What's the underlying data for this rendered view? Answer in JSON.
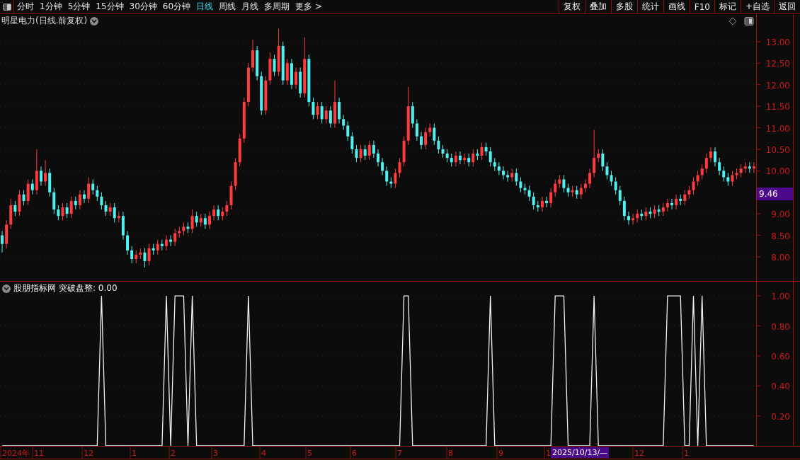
{
  "toolbar": {
    "periods": [
      {
        "label": "分时",
        "selected": false
      },
      {
        "label": "1分钟",
        "selected": false
      },
      {
        "label": "5分钟",
        "selected": false
      },
      {
        "label": "15分钟",
        "selected": false
      },
      {
        "label": "30分钟",
        "selected": false
      },
      {
        "label": "60分钟",
        "selected": false
      },
      {
        "label": "日线",
        "selected": true
      },
      {
        "label": "周线",
        "selected": false
      },
      {
        "label": "月线",
        "selected": false
      },
      {
        "label": "多周期",
        "selected": false
      },
      {
        "label": "更多 >",
        "selected": false
      }
    ],
    "actions": [
      "复权",
      "叠加",
      "多股",
      "统计",
      "画线",
      "F10",
      "标记",
      "+自选",
      "返回"
    ]
  },
  "main_chart": {
    "title": "明星电力(日线.前复权)",
    "current_price": "9.46",
    "chart_data": {
      "type": "candlestick",
      "grid": true,
      "ylim": [
        7.44,
        13.64
      ],
      "yticks": [
        {
          "value": 13,
          "label": "13.00"
        },
        {
          "value": 12.5,
          "label": "12.50"
        },
        {
          "value": 12,
          "label": "12.00"
        },
        {
          "value": 11.5,
          "label": "11.50"
        },
        {
          "value": 11,
          "label": "11.00"
        },
        {
          "value": 10.5,
          "label": "10.50"
        },
        {
          "value": 10,
          "label": "10.00"
        },
        {
          "value": 9,
          "label": "9.00"
        },
        {
          "value": 8.5,
          "label": "8.50"
        },
        {
          "value": 8,
          "label": "8.00"
        }
      ],
      "ohlc": [
        [
          8.5,
          8.6,
          8.1,
          8.3
        ],
        [
          8.3,
          8.85,
          8.2,
          8.75
        ],
        [
          8.75,
          9.35,
          8.65,
          9.2
        ],
        [
          9.2,
          9.3,
          8.95,
          9.05
        ],
        [
          9.05,
          9.55,
          8.95,
          9.45
        ],
        [
          9.45,
          9.55,
          9.2,
          9.3
        ],
        [
          9.3,
          9.8,
          9.2,
          9.7
        ],
        [
          9.7,
          9.8,
          9.45,
          9.55
        ],
        [
          9.55,
          10.5,
          9.45,
          10.0
        ],
        [
          10.0,
          10.1,
          9.65,
          9.75
        ],
        [
          9.75,
          10.25,
          9.65,
          9.95
        ],
        [
          9.95,
          10.05,
          9.4,
          9.5
        ],
        [
          9.5,
          9.6,
          9.0,
          9.1
        ],
        [
          9.1,
          9.2,
          8.85,
          8.95
        ],
        [
          8.95,
          9.25,
          8.85,
          9.15
        ],
        [
          9.15,
          9.25,
          8.9,
          9.0
        ],
        [
          9.0,
          9.4,
          8.9,
          9.3
        ],
        [
          9.3,
          9.4,
          9.1,
          9.2
        ],
        [
          9.2,
          9.55,
          9.1,
          9.45
        ],
        [
          9.45,
          9.55,
          9.25,
          9.35
        ],
        [
          9.35,
          9.85,
          9.25,
          9.7
        ],
        [
          9.7,
          9.8,
          9.45,
          9.55
        ],
        [
          9.55,
          9.65,
          9.3,
          9.4
        ],
        [
          9.4,
          9.5,
          9.1,
          9.2
        ],
        [
          9.2,
          9.3,
          8.95,
          9.05
        ],
        [
          9.05,
          9.25,
          8.95,
          9.15
        ],
        [
          9.15,
          9.25,
          8.8,
          8.9
        ],
        [
          8.9,
          9.05,
          8.8,
          8.95
        ],
        [
          8.95,
          9.05,
          8.4,
          8.5
        ],
        [
          8.5,
          8.6,
          8.05,
          8.15
        ],
        [
          8.15,
          8.25,
          7.85,
          7.95
        ],
        [
          7.95,
          8.15,
          7.85,
          8.05
        ],
        [
          8.05,
          8.2,
          7.95,
          8.1
        ],
        [
          8.1,
          8.2,
          7.75,
          7.9
        ],
        [
          7.9,
          8.3,
          7.8,
          8.2
        ],
        [
          8.2,
          8.3,
          8.05,
          8.15
        ],
        [
          8.15,
          8.4,
          8.05,
          8.3
        ],
        [
          8.3,
          8.4,
          8.15,
          8.25
        ],
        [
          8.25,
          8.5,
          8.15,
          8.4
        ],
        [
          8.4,
          8.5,
          8.25,
          8.35
        ],
        [
          8.35,
          8.65,
          8.25,
          8.55
        ],
        [
          8.55,
          8.7,
          8.45,
          8.6
        ],
        [
          8.6,
          8.8,
          8.5,
          8.7
        ],
        [
          8.7,
          8.8,
          8.55,
          8.65
        ],
        [
          8.65,
          9.1,
          8.55,
          8.95
        ],
        [
          8.95,
          9.05,
          8.7,
          8.8
        ],
        [
          8.8,
          9.0,
          8.7,
          8.9
        ],
        [
          8.9,
          9.0,
          8.65,
          8.75
        ],
        [
          8.75,
          9.05,
          8.65,
          8.95
        ],
        [
          8.95,
          9.2,
          8.85,
          9.1
        ],
        [
          9.1,
          9.2,
          8.85,
          8.95
        ],
        [
          8.95,
          9.15,
          8.85,
          9.05
        ],
        [
          9.05,
          9.3,
          8.95,
          9.2
        ],
        [
          9.2,
          9.75,
          9.1,
          9.65
        ],
        [
          9.65,
          10.3,
          9.55,
          10.2
        ],
        [
          10.2,
          10.85,
          10.1,
          10.75
        ],
        [
          10.75,
          11.7,
          10.65,
          11.6
        ],
        [
          11.6,
          12.5,
          11.5,
          12.4
        ],
        [
          12.4,
          13.05,
          12.3,
          12.8
        ],
        [
          12.8,
          12.9,
          12.1,
          12.2
        ],
        [
          12.2,
          12.3,
          11.3,
          11.4
        ],
        [
          11.4,
          12.2,
          11.3,
          12.1
        ],
        [
          12.1,
          12.75,
          12.0,
          12.6
        ],
        [
          12.6,
          12.7,
          12.2,
          12.3
        ],
        [
          12.3,
          13.3,
          12.2,
          12.9
        ],
        [
          12.9,
          13.0,
          12.0,
          12.1
        ],
        [
          12.1,
          12.6,
          12.0,
          12.5
        ],
        [
          12.5,
          12.6,
          11.9,
          12.0
        ],
        [
          12.0,
          12.4,
          11.9,
          12.3
        ],
        [
          12.3,
          12.4,
          11.7,
          11.8
        ],
        [
          11.8,
          13.1,
          11.7,
          12.6
        ],
        [
          12.6,
          12.7,
          11.5,
          11.6
        ],
        [
          11.6,
          11.7,
          11.2,
          11.3
        ],
        [
          11.3,
          11.6,
          11.2,
          11.5
        ],
        [
          11.5,
          11.6,
          11.1,
          11.2
        ],
        [
          11.2,
          11.5,
          11.1,
          11.4
        ],
        [
          11.4,
          11.5,
          11.0,
          11.1
        ],
        [
          11.1,
          12.1,
          11.0,
          11.6
        ],
        [
          11.6,
          11.7,
          11.1,
          11.2
        ],
        [
          11.2,
          11.3,
          10.95,
          11.05
        ],
        [
          11.05,
          11.15,
          10.7,
          10.8
        ],
        [
          10.8,
          10.9,
          10.4,
          10.5
        ],
        [
          10.5,
          10.6,
          10.2,
          10.3
        ],
        [
          10.3,
          10.6,
          10.2,
          10.5
        ],
        [
          10.5,
          10.6,
          10.25,
          10.35
        ],
        [
          10.35,
          10.7,
          10.25,
          10.6
        ],
        [
          10.6,
          10.7,
          10.3,
          10.4
        ],
        [
          10.4,
          10.5,
          10.1,
          10.2
        ],
        [
          10.2,
          10.3,
          9.9,
          10.0
        ],
        [
          10.0,
          10.1,
          9.65,
          9.75
        ],
        [
          9.75,
          9.85,
          9.6,
          9.7
        ],
        [
          9.7,
          10.05,
          9.6,
          9.95
        ],
        [
          9.95,
          10.3,
          9.85,
          10.2
        ],
        [
          10.2,
          10.8,
          10.1,
          10.7
        ],
        [
          10.7,
          11.95,
          10.6,
          11.5
        ],
        [
          11.5,
          11.6,
          11.0,
          11.1
        ],
        [
          11.1,
          11.2,
          10.7,
          10.8
        ],
        [
          10.8,
          10.9,
          10.5,
          10.6
        ],
        [
          10.6,
          11.0,
          10.5,
          10.9
        ],
        [
          10.9,
          11.1,
          10.8,
          11.0
        ],
        [
          11.0,
          11.1,
          10.6,
          10.7
        ],
        [
          10.7,
          10.8,
          10.4,
          10.5
        ],
        [
          10.5,
          10.6,
          10.3,
          10.4
        ],
        [
          10.4,
          10.5,
          10.2,
          10.3
        ],
        [
          10.3,
          10.4,
          10.1,
          10.2
        ],
        [
          10.2,
          10.45,
          10.1,
          10.35
        ],
        [
          10.35,
          10.45,
          10.15,
          10.25
        ],
        [
          10.25,
          10.4,
          10.15,
          10.3
        ],
        [
          10.3,
          10.4,
          10.1,
          10.2
        ],
        [
          10.2,
          10.5,
          10.1,
          10.4
        ],
        [
          10.4,
          10.5,
          10.25,
          10.35
        ],
        [
          10.35,
          10.65,
          10.25,
          10.55
        ],
        [
          10.55,
          10.65,
          10.35,
          10.45
        ],
        [
          10.45,
          10.55,
          10.1,
          10.2
        ],
        [
          10.2,
          10.3,
          10.0,
          10.1
        ],
        [
          10.1,
          10.2,
          9.9,
          10.0
        ],
        [
          10.0,
          10.1,
          9.8,
          9.9
        ],
        [
          9.9,
          10.0,
          9.75,
          9.85
        ],
        [
          9.85,
          10.05,
          9.75,
          9.95
        ],
        [
          9.95,
          10.05,
          9.65,
          9.75
        ],
        [
          9.75,
          9.85,
          9.5,
          9.6
        ],
        [
          9.6,
          9.7,
          9.45,
          9.55
        ],
        [
          9.55,
          9.65,
          9.3,
          9.4
        ],
        [
          9.4,
          9.5,
          9.1,
          9.2
        ],
        [
          9.2,
          9.3,
          9.05,
          9.15
        ],
        [
          9.15,
          9.4,
          9.05,
          9.3
        ],
        [
          9.3,
          9.4,
          9.15,
          9.25
        ],
        [
          9.25,
          9.6,
          9.15,
          9.5
        ],
        [
          9.5,
          9.8,
          9.4,
          9.7
        ],
        [
          9.7,
          9.9,
          9.6,
          9.8
        ],
        [
          9.8,
          9.9,
          9.5,
          9.6
        ],
        [
          9.6,
          9.7,
          9.4,
          9.5
        ],
        [
          9.5,
          9.65,
          9.4,
          9.55
        ],
        [
          9.55,
          9.65,
          9.35,
          9.45
        ],
        [
          9.45,
          9.7,
          9.35,
          9.6
        ],
        [
          9.6,
          9.8,
          9.5,
          9.7
        ],
        [
          9.7,
          10.05,
          9.6,
          9.95
        ],
        [
          9.95,
          10.95,
          9.85,
          10.3
        ],
        [
          10.3,
          10.5,
          10.2,
          10.4
        ],
        [
          10.4,
          10.5,
          10.0,
          10.1
        ],
        [
          10.1,
          10.2,
          9.8,
          9.9
        ],
        [
          9.9,
          10.0,
          9.65,
          9.75
        ],
        [
          9.75,
          9.85,
          9.45,
          9.55
        ],
        [
          9.55,
          9.65,
          9.2,
          9.3
        ],
        [
          9.3,
          9.4,
          8.85,
          8.95
        ],
        [
          8.95,
          9.05,
          8.75,
          8.85
        ],
        [
          8.85,
          9.0,
          8.75,
          8.9
        ],
        [
          8.9,
          9.1,
          8.8,
          9.0
        ],
        [
          9.0,
          9.1,
          8.85,
          8.95
        ],
        [
          8.95,
          9.15,
          8.85,
          9.05
        ],
        [
          9.05,
          9.15,
          8.9,
          9.0
        ],
        [
          9.0,
          9.2,
          8.9,
          9.1
        ],
        [
          9.1,
          9.2,
          8.95,
          9.05
        ],
        [
          9.05,
          9.25,
          8.95,
          9.15
        ],
        [
          9.15,
          9.35,
          9.05,
          9.25
        ],
        [
          9.25,
          9.35,
          9.1,
          9.2
        ],
        [
          9.2,
          9.45,
          9.1,
          9.35
        ],
        [
          9.35,
          9.45,
          9.2,
          9.3
        ],
        [
          9.3,
          9.55,
          9.2,
          9.45
        ],
        [
          9.45,
          9.65,
          9.35,
          9.55
        ],
        [
          9.55,
          9.85,
          9.45,
          9.75
        ],
        [
          9.75,
          10.0,
          9.65,
          9.9
        ],
        [
          9.9,
          10.15,
          9.8,
          10.05
        ],
        [
          10.05,
          10.4,
          9.95,
          10.3
        ],
        [
          10.3,
          10.55,
          10.2,
          10.45
        ],
        [
          10.45,
          10.55,
          10.1,
          10.2
        ],
        [
          10.2,
          10.3,
          9.9,
          10.0
        ],
        [
          10.0,
          10.1,
          9.75,
          9.85
        ],
        [
          9.85,
          9.95,
          9.65,
          9.75
        ],
        [
          9.75,
          10.0,
          9.65,
          9.9
        ],
        [
          9.9,
          10.05,
          9.8,
          9.95
        ],
        [
          9.95,
          10.15,
          9.85,
          10.05
        ],
        [
          10.05,
          10.2,
          9.95,
          10.1
        ],
        [
          10.1,
          10.2,
          9.95,
          10.05
        ],
        [
          10.05,
          10.2,
          9.95,
          10.1
        ]
      ]
    }
  },
  "indicator": {
    "source": "股朋指标网",
    "reading": ": 0.00",
    "chart_data": {
      "type": "line",
      "grid": true,
      "ylim": [
        0,
        1.095
      ],
      "yticks": [
        {
          "value": 1,
          "label": "1.00"
        },
        {
          "value": 0.8,
          "label": "0.80"
        },
        {
          "value": 0.6,
          "label": "0.60"
        },
        {
          "value": 0.4,
          "label": "0.40"
        },
        {
          "value": 0.2,
          "label": "0.20"
        }
      ],
      "series": [
        {
          "name": "突破盘整",
          "color": "#f2f2f2",
          "values": [
            0,
            0,
            0,
            0,
            0,
            0,
            0,
            0,
            0,
            0,
            0,
            0,
            0,
            0,
            0,
            0,
            0,
            0,
            0,
            0,
            0,
            0,
            0,
            1,
            0,
            0,
            0,
            0,
            0,
            0,
            0,
            0,
            0,
            0,
            0,
            0,
            0,
            0,
            1,
            0,
            1,
            1,
            1,
            0,
            1,
            0,
            0,
            0,
            0,
            0,
            0,
            0,
            0,
            0,
            0,
            0,
            0,
            1,
            0,
            0,
            0,
            0,
            0,
            0,
            0,
            0,
            0,
            0,
            0,
            0,
            0,
            0,
            0,
            0,
            0,
            0,
            0,
            0,
            0,
            0,
            0,
            0,
            0,
            0,
            0,
            0,
            0,
            0,
            0,
            0,
            0,
            0,
            0,
            1,
            1,
            0,
            0,
            0,
            0,
            0,
            0,
            0,
            0,
            0,
            0,
            0,
            0,
            0,
            0,
            0,
            0,
            0,
            0,
            1,
            0,
            0,
            0,
            0,
            0,
            0,
            0,
            0,
            0,
            0,
            0,
            0,
            0,
            0,
            1,
            1,
            1,
            0,
            0,
            0,
            0,
            0,
            0,
            1,
            0,
            0,
            0,
            0,
            0,
            0,
            0,
            0,
            0,
            0,
            0,
            0,
            0,
            0,
            0,
            0,
            1,
            1,
            1,
            1,
            0,
            0,
            1,
            0,
            1,
            0,
            0,
            0,
            0,
            0,
            0,
            0,
            0,
            0,
            0,
            0,
            0
          ]
        }
      ]
    }
  },
  "time_axis": {
    "labels": [
      "2024年",
      "11",
      "12",
      "1",
      "2",
      "3",
      "4",
      "5",
      "6",
      "7",
      "8",
      "9",
      "1",
      "12",
      "1"
    ],
    "cursor_date": "2025/10/13/—"
  }
}
